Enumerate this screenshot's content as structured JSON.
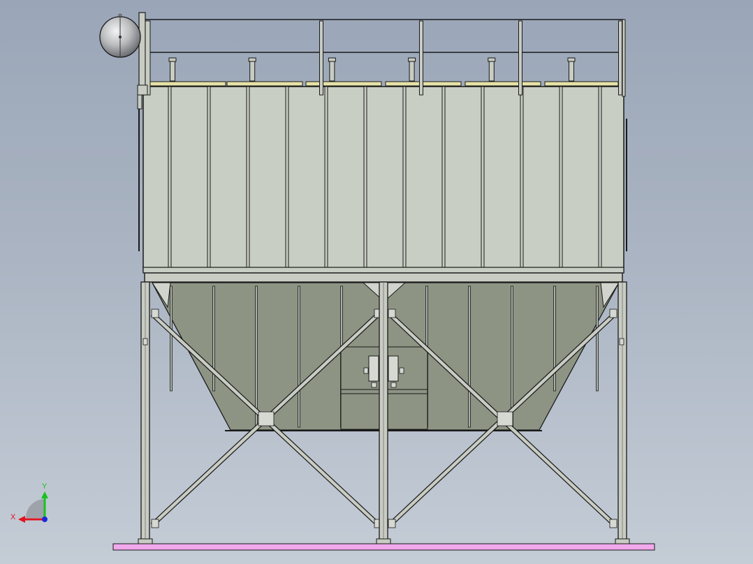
{
  "model": {
    "name": "",
    "view": "front"
  },
  "triad": {
    "x_label": "X",
    "y_label": "Y",
    "x_color": "#e0141e",
    "y_color": "#18c21e",
    "z_color": "#1a2ad8"
  },
  "colors": {
    "background_top": "#9aa6b8",
    "background_bottom": "#c4ccd6",
    "body_panel": "#c9cec4",
    "hopper": "#8d9484",
    "steel": "#c8ccc2",
    "edge": "#1a1a1a",
    "top_plate": "#e6e2a6",
    "base_plate": "#f2a9ec",
    "tank": "#b9bbbd"
  },
  "components": {
    "filter_pipe_count": 6,
    "body_stiffener_count": 12,
    "hopper_rib_count": 11,
    "support_column_count": 3,
    "railing_post_count": 6
  }
}
